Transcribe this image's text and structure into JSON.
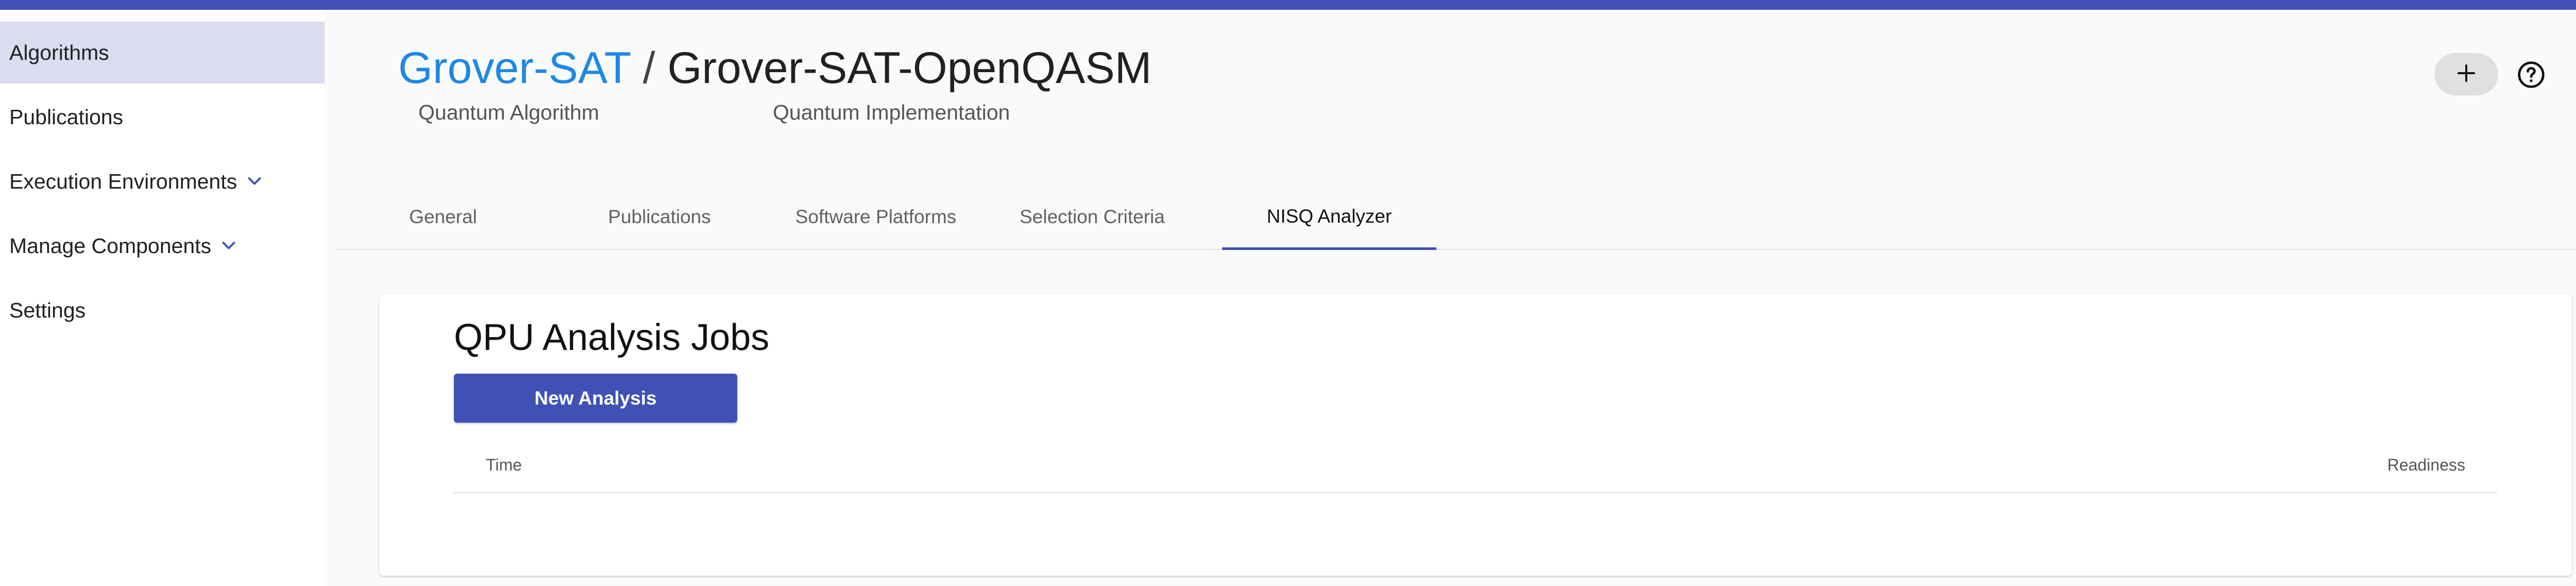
{
  "sidebar": {
    "items": [
      {
        "label": "Algorithms",
        "active": true
      },
      {
        "label": "Publications"
      },
      {
        "label": "Execution Environments",
        "expandable": true
      },
      {
        "label": "Manage Components",
        "expandable": true
      },
      {
        "label": "Settings"
      }
    ]
  },
  "header": {
    "breadcrumb": {
      "parent": "Grover-SAT",
      "separator": "/",
      "current": "Grover-SAT-OpenQASM"
    },
    "parent_subtitle": "Quantum Algorithm",
    "current_subtitle": "Quantum Implementation",
    "add_icon": "plus-icon",
    "help_icon": "help-circle-icon"
  },
  "tabs": [
    {
      "label": "General"
    },
    {
      "label": "Publications"
    },
    {
      "label": "Software Platforms"
    },
    {
      "label": "Selection Criteria"
    },
    {
      "label": "NISQ Analyzer",
      "active": true
    }
  ],
  "card": {
    "title": "QPU Analysis Jobs",
    "new_button": "New Analysis",
    "columns": [
      "Time",
      "Readiness"
    ]
  },
  "colors": {
    "primary": "#3f51b5",
    "link": "#1e88e5",
    "active_nav_bg": "#dadcef"
  }
}
